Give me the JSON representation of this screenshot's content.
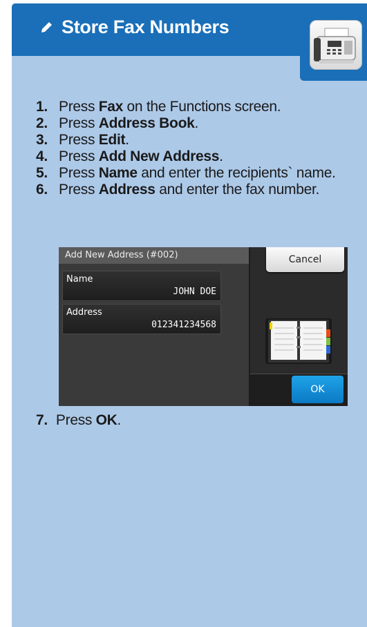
{
  "header": {
    "title": "Store Fax Numbers",
    "icon": "pencil-icon",
    "badge_icon": "fax-machine-icon",
    "color": "#1a6fb8"
  },
  "steps": [
    {
      "num": "1.",
      "pre": "Press ",
      "bold": "Fax",
      "post": " on the Functions screen."
    },
    {
      "num": "2.",
      "pre": "Press ",
      "bold": "Address Book",
      "post": "."
    },
    {
      "num": "3.",
      "pre": "Press ",
      "bold": "Edit",
      "post": "."
    },
    {
      "num": "4.",
      "pre": "Press ",
      "bold": "Add New Address",
      "post": "."
    },
    {
      "num": "5.",
      "pre": "Press ",
      "bold": "Name",
      "post": " and enter the recipients` name."
    },
    {
      "num": "6.",
      "pre": "Press ",
      "bold": "Address",
      "post": " and enter the fax number."
    }
  ],
  "step7": {
    "num": "7.",
    "pre": "Press ",
    "bold": "OK",
    "post": "."
  },
  "lcd": {
    "title": "Add New Address (#002)",
    "name_label": "Name",
    "name_value": "JOHN DOE",
    "address_label": "Address",
    "address_value": "012341234568",
    "cancel_label": "Cancel",
    "ok_label": "OK",
    "book_icon": "address-book-icon"
  },
  "colors": {
    "panel": "#adc9e8",
    "ok_button": "#1591d8"
  }
}
